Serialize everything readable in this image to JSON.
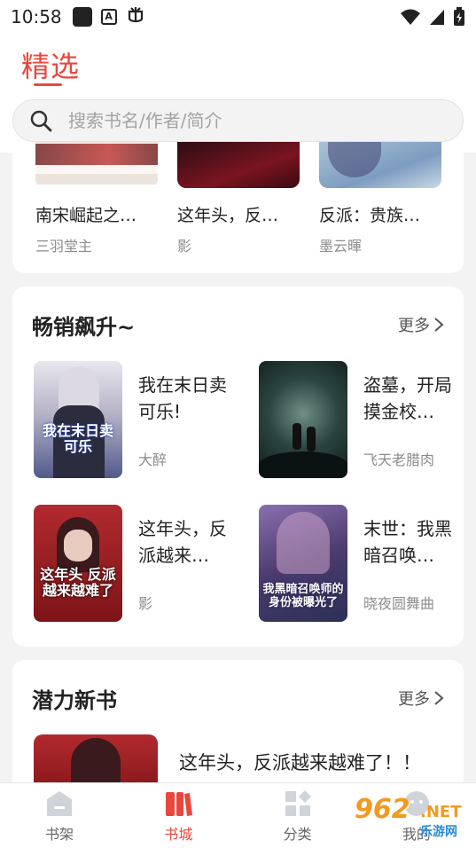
{
  "status_bar": {
    "time": "10:58",
    "a_icon_text": "A"
  },
  "header": {
    "title": "精选"
  },
  "search": {
    "placeholder": "搜索书名/作者/简介"
  },
  "top_row": {
    "items": [
      {
        "name": "南宋崛起之…",
        "author": "三羽堂主"
      },
      {
        "name": "这年头，反…",
        "author": "影"
      },
      {
        "name": "反派：贵族…",
        "author": "墨云暉"
      }
    ]
  },
  "bestseller": {
    "title": "畅销飙升~",
    "more": "更多",
    "items": [
      {
        "title": "我在末日卖可乐!",
        "author": "大醉",
        "cover_text": "我在末日卖可乐",
        "cover_color": "#7c8aa8"
      },
      {
        "title": "盗墓，开局摸金校…",
        "author": "飞天老腊肉",
        "cover_text": "",
        "cover_color": "#1f3a36"
      },
      {
        "title": "这年头，反派越来…",
        "author": "影",
        "cover_text": "这年头 反派越来越难了",
        "cover_color": "#9e1f24"
      },
      {
        "title": "末世：我黑暗召唤…",
        "author": "晓夜圆舞曲",
        "cover_text": "我黑暗召唤师的身份被曝光了",
        "cover_color": "#5a4f7a"
      }
    ]
  },
  "new_books": {
    "title": "潜力新书",
    "more": "更多",
    "first": {
      "title": "这年头，反派越来越难了！！"
    }
  },
  "tabbar": {
    "tabs": [
      {
        "label": "书架",
        "active": false
      },
      {
        "label": "书城",
        "active": true
      },
      {
        "label": "分类",
        "active": false
      },
      {
        "label": "我的",
        "active": false
      }
    ]
  },
  "watermark": {
    "main": "962",
    "net": ".NET",
    "sub": "乐游网"
  },
  "colors": {
    "accent": "#e8473d",
    "muted": "#8c8c8c",
    "watermark": "#f39a1e"
  }
}
